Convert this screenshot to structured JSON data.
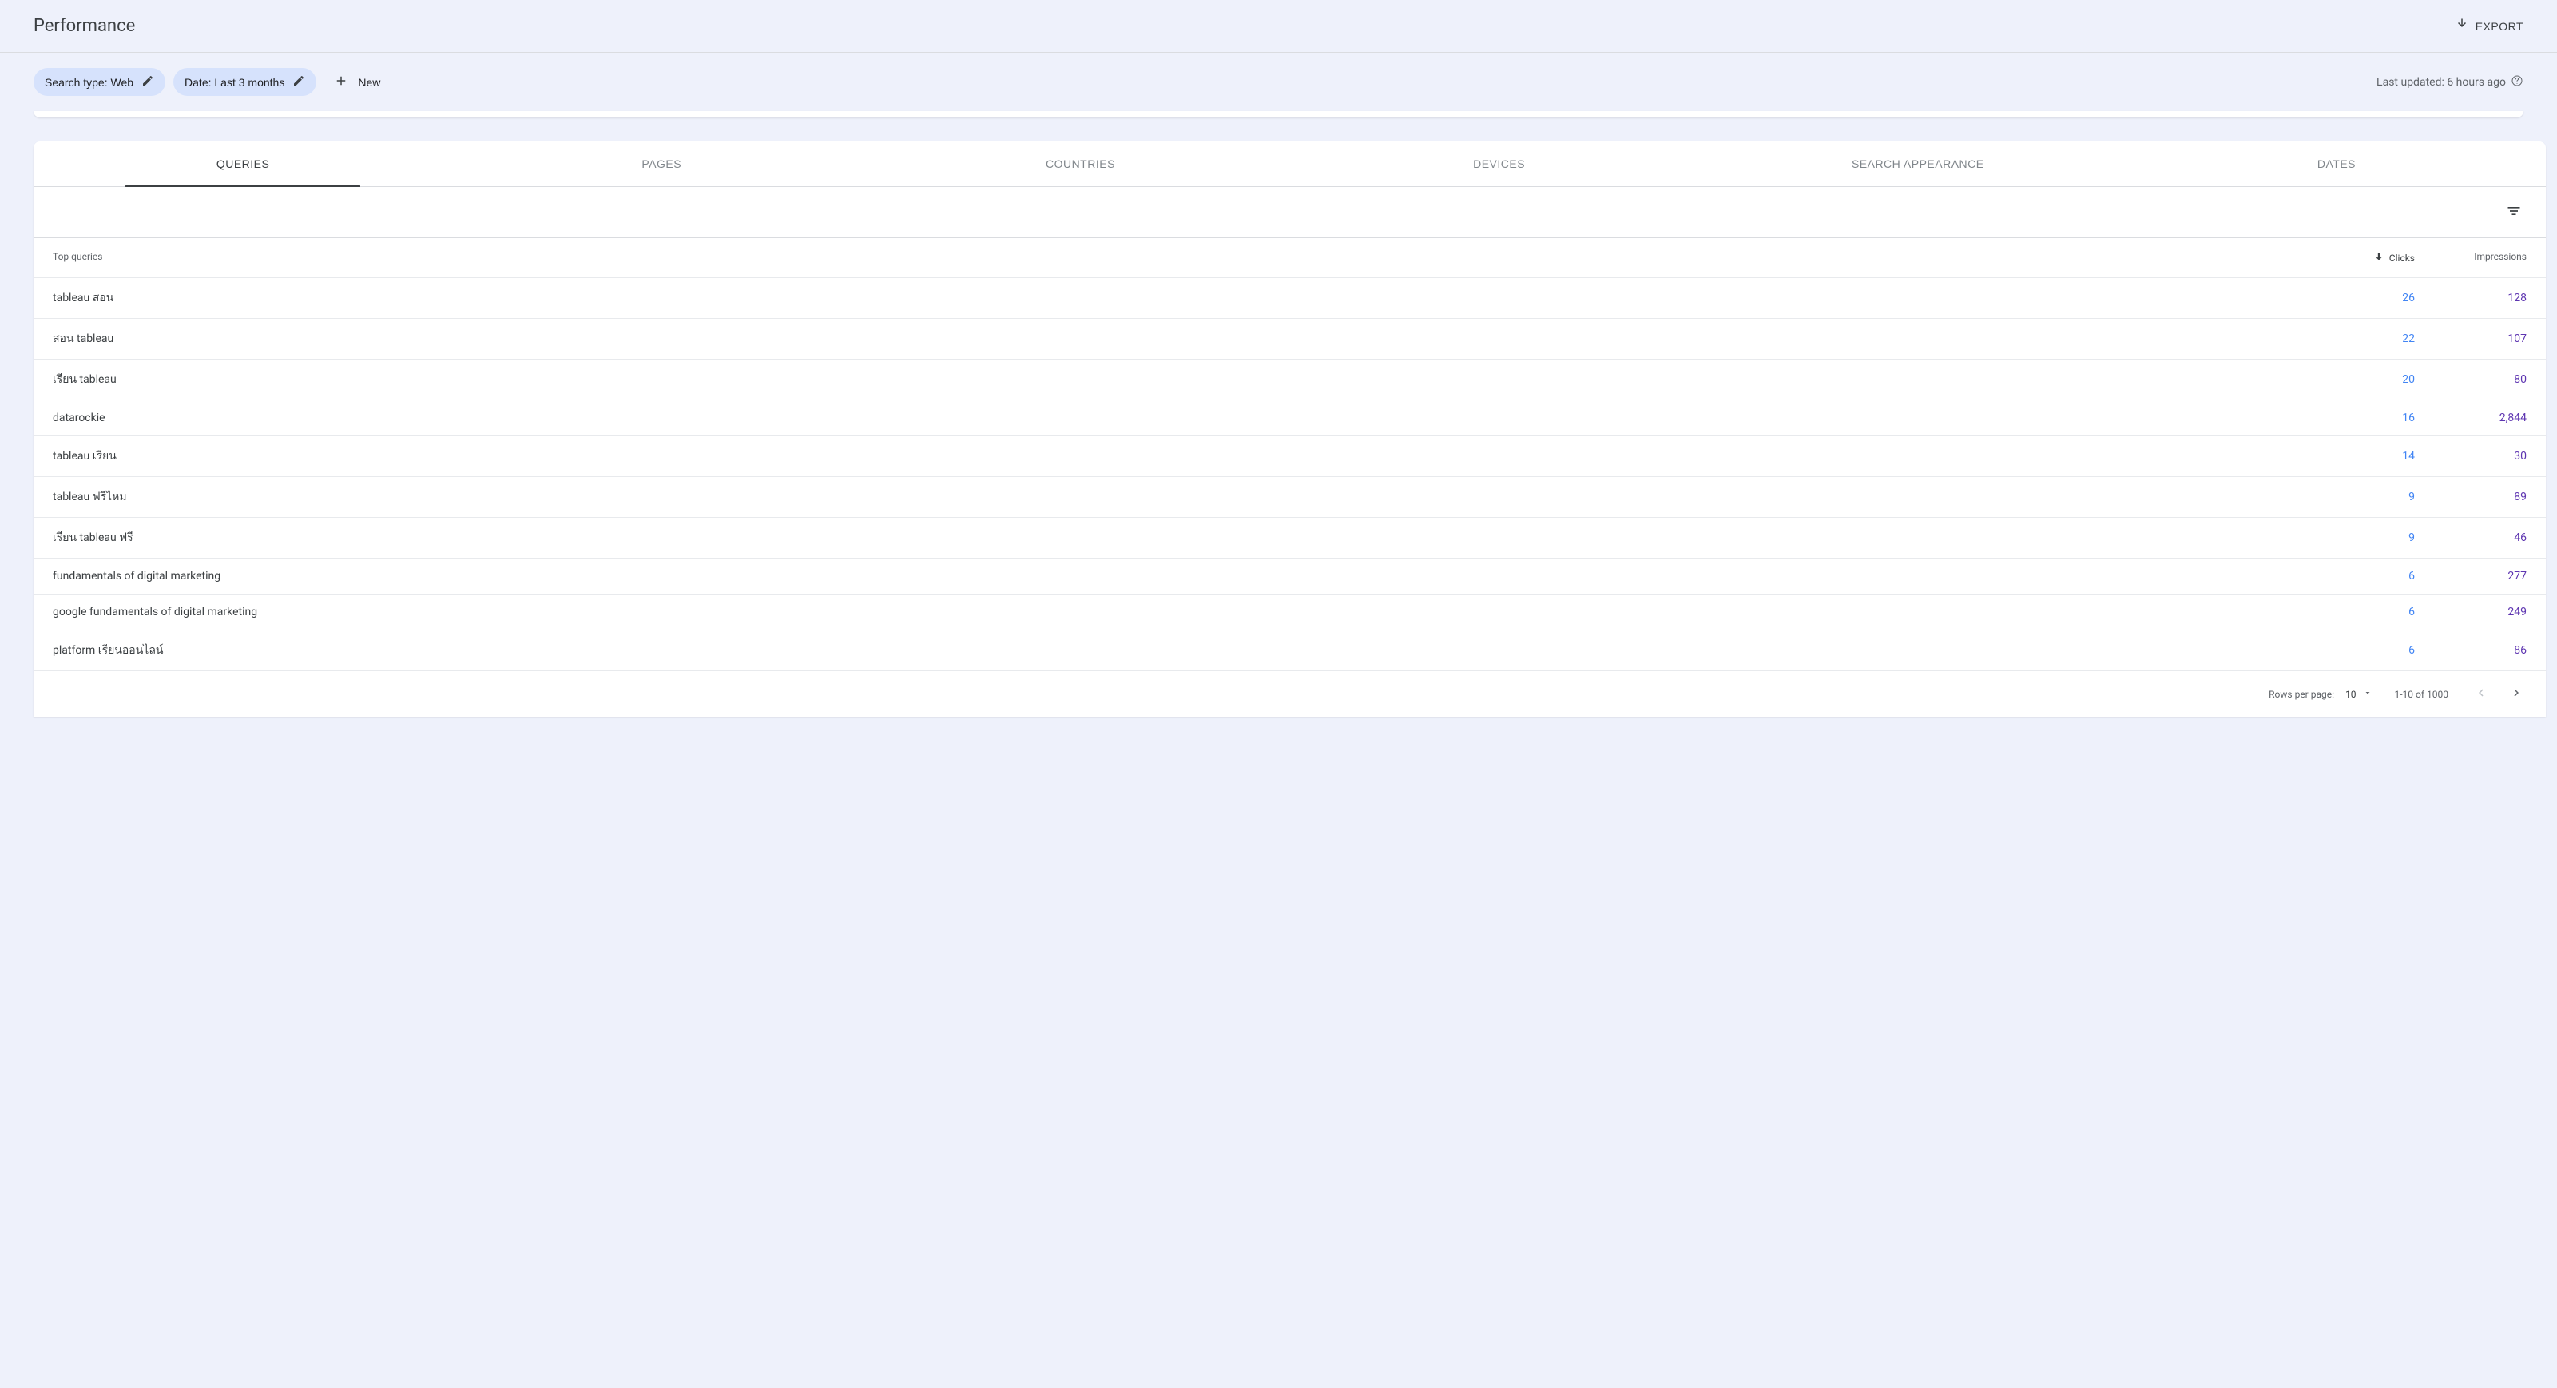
{
  "header": {
    "title": "Performance",
    "export_label": "EXPORT"
  },
  "filters": {
    "search_type_label": "Search type: Web",
    "date_label": "Date: Last 3 months",
    "new_label": "New"
  },
  "last_updated": "Last updated: 6 hours ago",
  "tabs": [
    {
      "label": "QUERIES",
      "active": true
    },
    {
      "label": "PAGES",
      "active": false
    },
    {
      "label": "COUNTRIES",
      "active": false
    },
    {
      "label": "DEVICES",
      "active": false
    },
    {
      "label": "SEARCH APPEARANCE",
      "active": false
    },
    {
      "label": "DATES",
      "active": false
    }
  ],
  "table": {
    "headers": {
      "query": "Top queries",
      "clicks": "Clicks",
      "impressions": "Impressions"
    },
    "rows": [
      {
        "query": "tableau สอน",
        "clicks": "26",
        "impressions": "128"
      },
      {
        "query": "สอน tableau",
        "clicks": "22",
        "impressions": "107"
      },
      {
        "query": "เรียน tableau",
        "clicks": "20",
        "impressions": "80"
      },
      {
        "query": "datarockie",
        "clicks": "16",
        "impressions": "2,844"
      },
      {
        "query": "tableau เรียน",
        "clicks": "14",
        "impressions": "30"
      },
      {
        "query": "tableau ฟรีไหม",
        "clicks": "9",
        "impressions": "89"
      },
      {
        "query": "เรียน tableau ฟรี",
        "clicks": "9",
        "impressions": "46"
      },
      {
        "query": "fundamentals of digital marketing",
        "clicks": "6",
        "impressions": "277"
      },
      {
        "query": "google fundamentals of digital marketing",
        "clicks": "6",
        "impressions": "249"
      },
      {
        "query": "platform เรียนออนไลน์",
        "clicks": "6",
        "impressions": "86"
      }
    ]
  },
  "pagination": {
    "rows_label": "Rows per page:",
    "rows_value": "10",
    "range_text": "1-10 of 1000"
  }
}
